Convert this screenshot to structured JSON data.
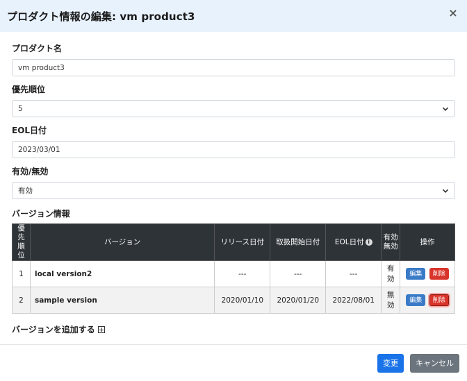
{
  "modal": {
    "title": "プロダクト情報の編集: vm product3",
    "close_glyph": "×"
  },
  "fields": {
    "product_name": {
      "label": "プロダクト名",
      "value": "vm product3"
    },
    "priority": {
      "label": "優先順位",
      "value": "5"
    },
    "eol_date": {
      "label": "EOL日付",
      "value": "2023/03/01"
    },
    "status": {
      "label": "有効/無効",
      "value": "有効"
    }
  },
  "versions": {
    "section_label": "バージョン情報",
    "headers": {
      "priority": "優先\n順位",
      "version": "バージョン",
      "release_date": "リリース日付",
      "handling_start": "取扱開始日付",
      "eol": "EOL日付",
      "valid": "有効\n無効",
      "actions": "操作"
    },
    "rows": [
      {
        "priority": "1",
        "version": "local version2",
        "release_date": "---",
        "handling_start": "---",
        "eol": "---",
        "valid": "有\n効",
        "edit_label": "編集",
        "delete_label": "削除"
      },
      {
        "priority": "2",
        "version": "sample version",
        "release_date": "2020/01/10",
        "handling_start": "2020/01/20",
        "eol": "2022/08/01",
        "valid": "無\n効",
        "edit_label": "編集",
        "delete_label": "削除"
      }
    ],
    "add_label": "バージョンを追加する"
  },
  "footer": {
    "submit_label": "変更",
    "cancel_label": "キャンセル"
  },
  "colors": {
    "header_bg": "#e8f2fc",
    "table_header_bg": "#2e3338",
    "primary": "#1a73e8",
    "secondary": "#6c757d",
    "edit": "#3a7bc8",
    "delete": "#d9342b"
  },
  "icons": {
    "close": "close-icon",
    "chevron": "chevron-down-icon",
    "info": "info-icon",
    "plus": "plus-square-icon"
  }
}
